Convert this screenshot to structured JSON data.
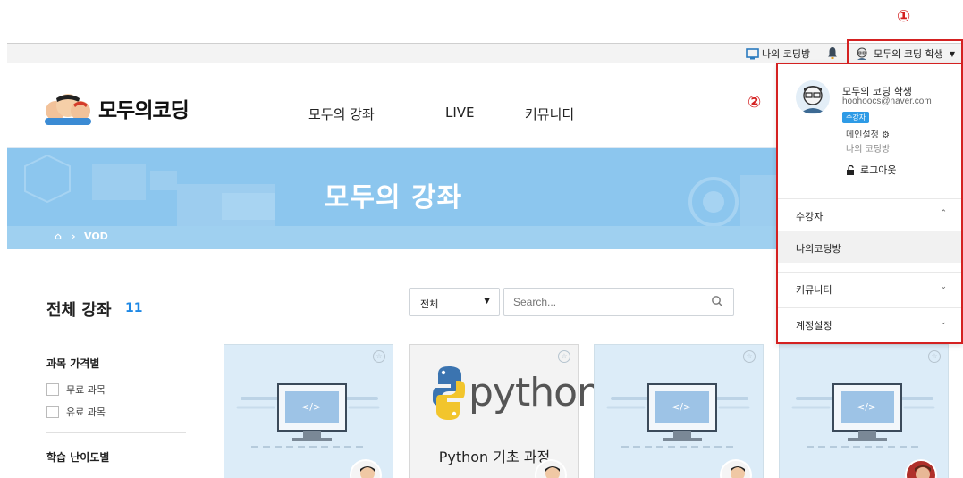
{
  "annotations": {
    "marker_1": "①",
    "marker_2": "②"
  },
  "topbar": {
    "my_room_label": "나의 코딩방",
    "user_label": "모두의 코딩 학생",
    "dropdown_caret": "▼"
  },
  "header": {
    "logo_text": "모두의코딩",
    "nav": [
      "모두의 강좌",
      "LIVE",
      "커뮤니티"
    ]
  },
  "banner": {
    "title": "모두의 강좌",
    "breadcrumb_home": "⌂",
    "breadcrumb_separator": "›",
    "breadcrumb_current": "VOD"
  },
  "course_list": {
    "title": "전체 강좌",
    "count": "11",
    "filter_select_value": "전체",
    "search_placeholder": "Search..."
  },
  "filters": {
    "price_heading": "과목 가격별",
    "price_options": [
      "무료 과목",
      "유료 과목"
    ],
    "level_heading": "학습 난이도별"
  },
  "cards": {
    "code_glyph": "</>",
    "python_word": "python",
    "python_subtitle": "Python 기초 과정"
  },
  "user_menu": {
    "name": "모두의 코딩 학생",
    "email": "hoohoocs@naver.com",
    "role_badge": "수강자",
    "main_settings": "메인설정",
    "my_room": "나의 코딩방",
    "logout": "로그아웃",
    "sections": [
      {
        "label": "수강자",
        "chevron": "⌃"
      },
      {
        "label": "나의코딩방",
        "chevron": ""
      },
      {
        "label": "커뮤니티",
        "chevron": "⌄"
      },
      {
        "label": "계정설정",
        "chevron": "⌄"
      }
    ]
  },
  "colors": {
    "annotation_red": "#d42121",
    "banner_blue": "#8cc6ee",
    "accent_blue": "#1e88e5",
    "card_blue": "#dcecf8"
  }
}
